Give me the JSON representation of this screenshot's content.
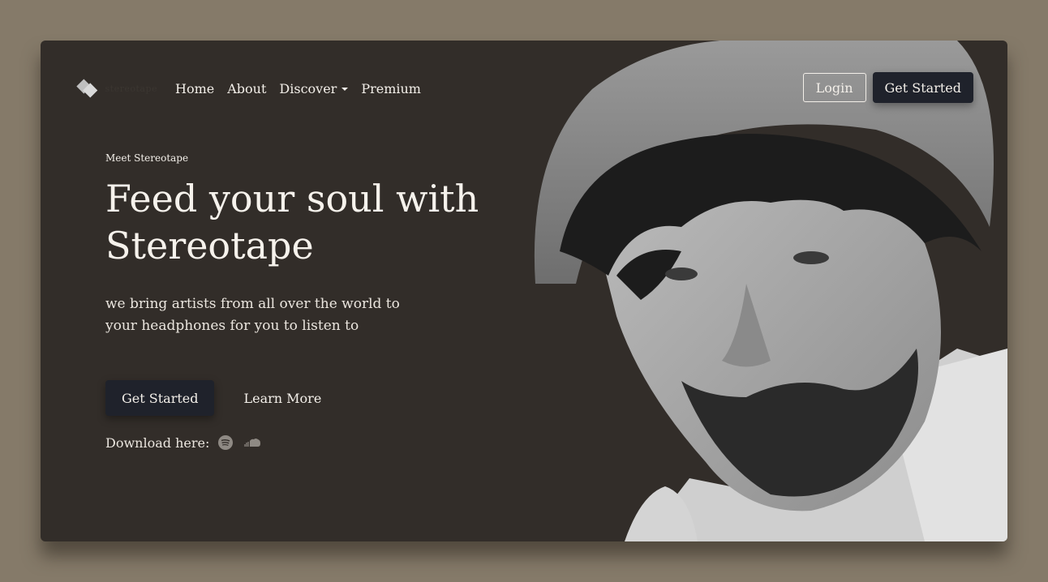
{
  "nav": {
    "logo_text": "stereotape",
    "links": [
      "Home",
      "About",
      "Discover",
      "Premium"
    ],
    "login_label": "Login",
    "get_started_label": "Get Started"
  },
  "hero": {
    "eyebrow": "Meet Stereotape",
    "headline_line1": "Feed your soul with",
    "headline_line2": "Stereotape",
    "subtitle": "we bring artists from all over the world to your headphones for you to listen to",
    "cta_primary": "Get Started",
    "cta_secondary": "Learn More",
    "download_label": "Download here:",
    "download_icons": [
      "spotify-icon",
      "soundcloud-icon"
    ]
  },
  "colors": {
    "page_bg": "#857a69",
    "card_bg": "#322d29",
    "button_dark": "#1f222b",
    "text_light": "#f3efe9"
  }
}
